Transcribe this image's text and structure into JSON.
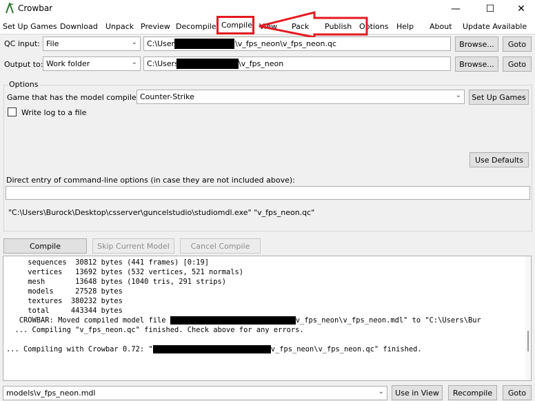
{
  "window": {
    "title": "Crowbar",
    "minimize": "—",
    "maximize": "☐",
    "close": "✕"
  },
  "tabs": [
    {
      "label": "Set Up Games"
    },
    {
      "label": "Download"
    },
    {
      "label": "Unpack"
    },
    {
      "label": "Preview"
    },
    {
      "label": "Decompile"
    },
    {
      "label": "Compile"
    },
    {
      "label": "View"
    },
    {
      "label": "Pack"
    },
    {
      "label": "Publish"
    },
    {
      "label": "Options"
    },
    {
      "label": "Help"
    },
    {
      "label": "About"
    },
    {
      "label": "Update Available"
    }
  ],
  "qc": {
    "label": "QC input:",
    "mode": "File",
    "path_prefix": "C:\\Users",
    "path_suffix": "\\v_fps_neon\\v_fps_neon.qc",
    "browse": "Browse...",
    "goto": "Goto"
  },
  "output": {
    "label": "Output to:",
    "mode": "Work folder",
    "path_prefix": "C:\\Users",
    "path_suffix": "\\v_fps_neon",
    "browse": "Browse...",
    "goto": "Goto"
  },
  "options": {
    "group_label": "Options",
    "game_label": "Game that has the model compiler:",
    "game_value": "Counter-Strike",
    "setup_games": "Set Up Games",
    "write_log": "Write log to a file",
    "use_defaults": "Use Defaults",
    "cmd_label": "Direct entry of command-line options (in case they are not included above):",
    "cmd_value": "",
    "command_preview": "\"C:\\Users\\Burock\\Desktop\\csserver\\guncelstudio\\studiomdl.exe\" \"v_fps_neon.qc\""
  },
  "actions": {
    "compile": "Compile",
    "skip": "Skip Current Model",
    "cancel": "Cancel Compile"
  },
  "log": {
    "l1": "     sequences  30812 bytes (441 frames) [0:19]",
    "l2": "     vertices   13692 bytes (532 vertices, 521 normals)",
    "l3": "     mesh       13648 bytes (1040 tris, 291 strips)",
    "l4": "     models     27528 bytes",
    "l5": "     textures  380232 bytes",
    "l6": "     total     443344 bytes",
    "l7a": "   CROWBAR: Moved compiled model file ",
    "l7b": "v_fps_neon\\v_fps_neon.mdl\" to \"C:\\Users\\Bur",
    "l8": "  ... Compiling \"v_fps_neon.qc\" finished. Check above for any errors.",
    "l9": "",
    "l10a": "... Compiling with Crowbar 0.72: \"",
    "l10b": "v_fps_neon\\v_fps_neon.qc\" finished."
  },
  "bottom": {
    "model": "models\\v_fps_neon.mdl",
    "use_in_view": "Use in View",
    "recompile": "Recompile",
    "goto": "Goto"
  },
  "colors": {
    "annotation": "#e5181f"
  }
}
